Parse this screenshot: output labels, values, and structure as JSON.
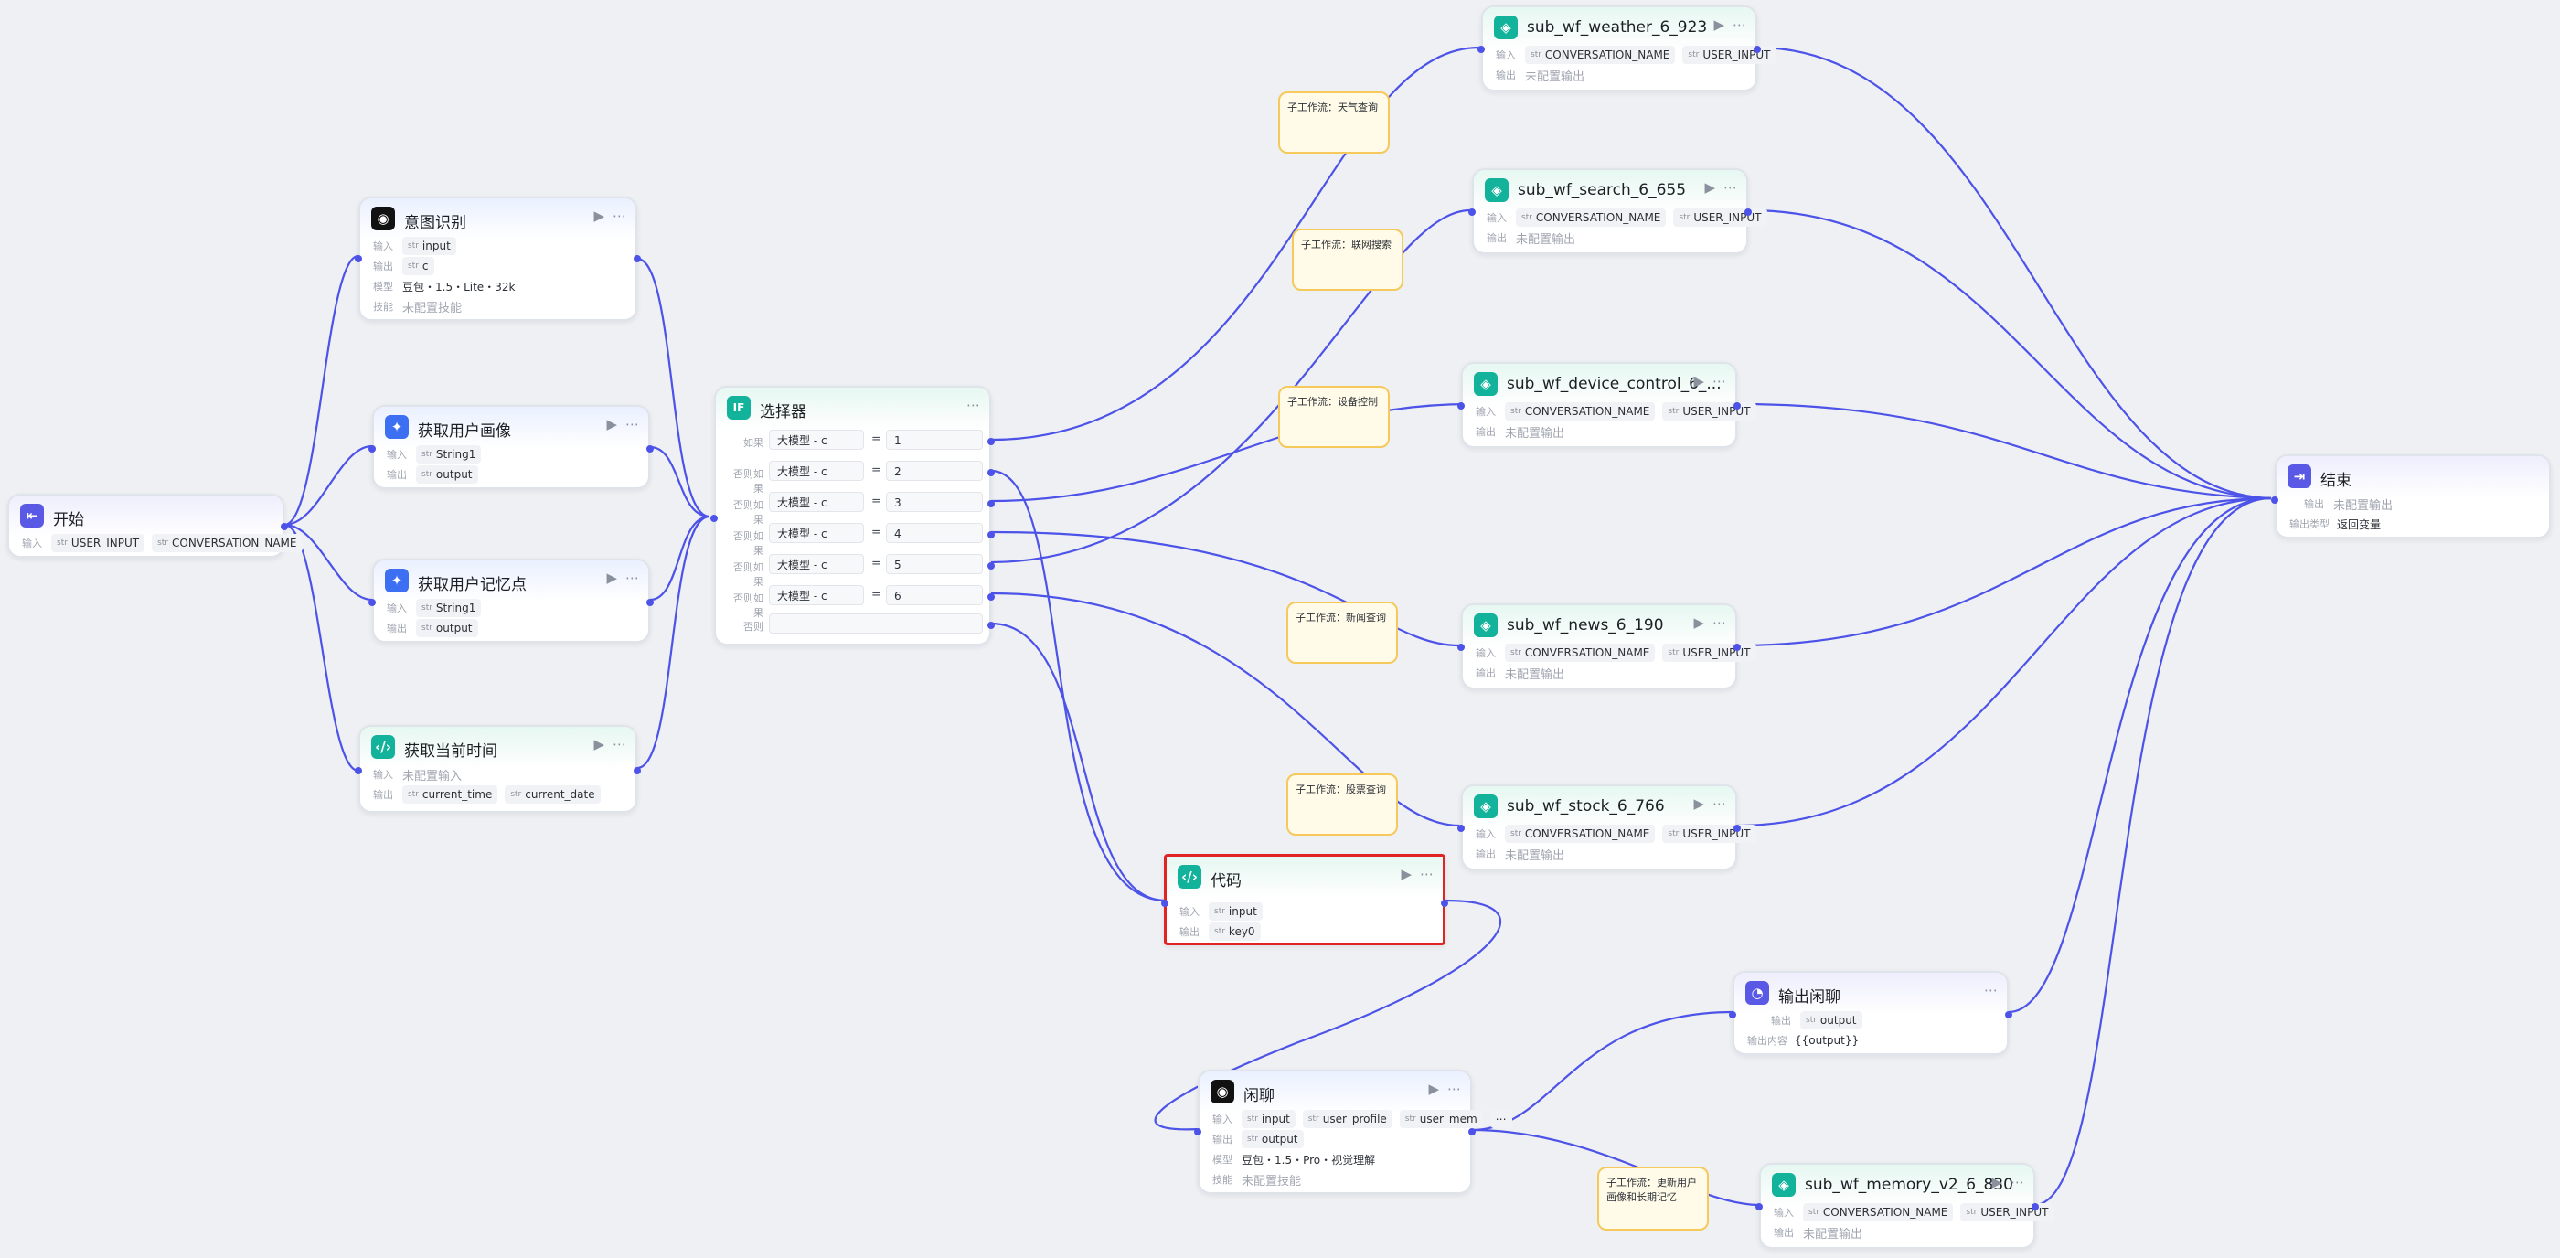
{
  "colors": {
    "edge": "#4d53e8",
    "selection": "#e02424",
    "note_bg": "#fffbe8",
    "note_border": "#f5c95b"
  },
  "labels": {
    "input": "输入",
    "output": "输出",
    "model": "模型",
    "skills": "技能",
    "not_configured_output": "未配置输出",
    "not_configured_input": "未配置输入",
    "not_configured_skill": "未配置技能",
    "output_type": "输出类型",
    "output_content": "输出内容",
    "return_var": "返回变量"
  },
  "start": {
    "title": "开始",
    "inputs": [
      "USER_INPUT",
      "CONVERSATION_NAME"
    ]
  },
  "intent": {
    "title": "意图识别",
    "input": "input",
    "output": "c",
    "model": "豆包・1.5・Lite・32k"
  },
  "profile": {
    "title": "获取用户画像",
    "input": "String1",
    "output": "output"
  },
  "memory": {
    "title": "获取用户记忆点",
    "input": "String1",
    "output": "output"
  },
  "time": {
    "title": "获取当前时间",
    "outputs": [
      "current_time",
      "current_date"
    ]
  },
  "selector": {
    "title": "选择器",
    "branches": [
      {
        "label": "如果",
        "var": "大模型 - c",
        "op": "=",
        "value": "1"
      },
      {
        "label": "否则如果",
        "var": "大模型 - c",
        "op": "=",
        "value": "2"
      },
      {
        "label": "否则如果",
        "var": "大模型 - c",
        "op": "=",
        "value": "3"
      },
      {
        "label": "否则如果",
        "var": "大模型 - c",
        "op": "=",
        "value": "4"
      },
      {
        "label": "否则如果",
        "var": "大模型 - c",
        "op": "=",
        "value": "5"
      },
      {
        "label": "否则如果",
        "var": "大模型 - c",
        "op": "=",
        "value": "6"
      }
    ],
    "else_label": "否则"
  },
  "code": {
    "title": "代码",
    "input": "input",
    "output": "key0"
  },
  "chat": {
    "title": "闲聊",
    "inputs": [
      "input",
      "user_profile",
      "user_mem"
    ],
    "output": "output",
    "model": "豆包・1.5・Pro・视觉理解"
  },
  "subs": {
    "inputs": [
      "CONVERSATION_NAME",
      "USER_INPUT"
    ],
    "weather": "sub_wf_weather_6_923",
    "search": "sub_wf_search_6_655",
    "device": "sub_wf_device_control_6_...",
    "news": "sub_wf_news_6_190",
    "stock": "sub_wf_stock_6_766",
    "memory_v2": "sub_wf_memory_v2_6_830"
  },
  "notes": {
    "weather": "子工作流：天气查询",
    "search": "子工作流：联网搜索",
    "device": "子工作流：设备控制",
    "news": "子工作流：新闻查询",
    "stock": "子工作流：股票查询",
    "memory": "子工作流：更新用户画像和长期记忆"
  },
  "output_chat": {
    "title": "输出闲聊",
    "output": "output",
    "content": "{{output}}"
  },
  "end": {
    "title": "结束",
    "return": "返回变量"
  }
}
